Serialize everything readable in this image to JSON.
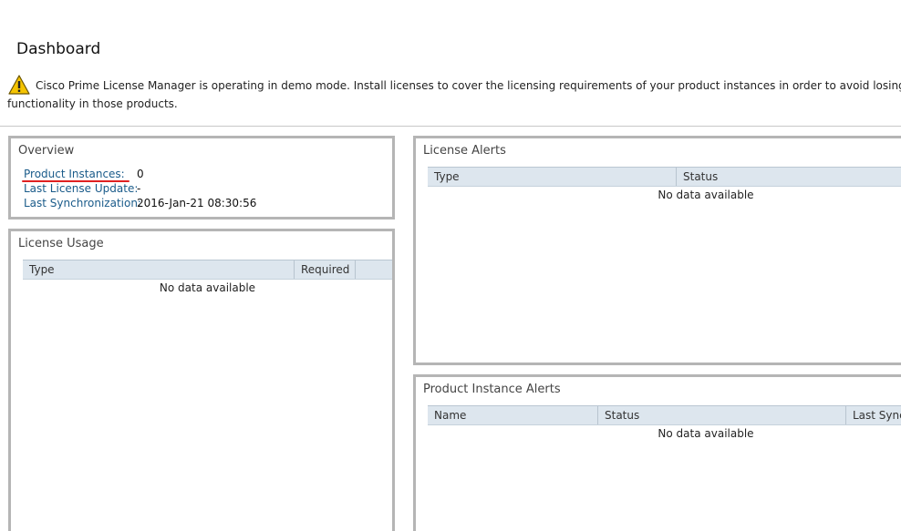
{
  "page": {
    "title": "Dashboard"
  },
  "banner": {
    "icon": "warning-triangle-icon",
    "message": "Cisco Prime License Manager is operating in demo mode. Install licenses to cover the licensing requirements of your product instances in order to avoid losing functionality in those products."
  },
  "overview": {
    "title": "Overview",
    "rows": [
      {
        "label": "Product Instances:",
        "value": "0"
      },
      {
        "label": "Last License Update:",
        "value": "-"
      },
      {
        "label": "Last Synchronization:",
        "value": "2016-Jan-21 08:30:56"
      }
    ]
  },
  "license_usage": {
    "title": "License Usage",
    "columns": [
      "Type",
      "Required"
    ],
    "empty_text": "No data available"
  },
  "license_alerts": {
    "title": "License Alerts",
    "columns": [
      "Type",
      "Status"
    ],
    "empty_text": "No data available"
  },
  "product_instance_alerts": {
    "title": "Product Instance Alerts",
    "columns": [
      "Name",
      "Status",
      "Last Synch"
    ],
    "empty_text": "No data available"
  },
  "colors": {
    "link": "#1a5b8a",
    "annotation_underline": "#e02020",
    "table_header_bg": "#dde6ee",
    "panel_border": "#b5b5b5"
  }
}
